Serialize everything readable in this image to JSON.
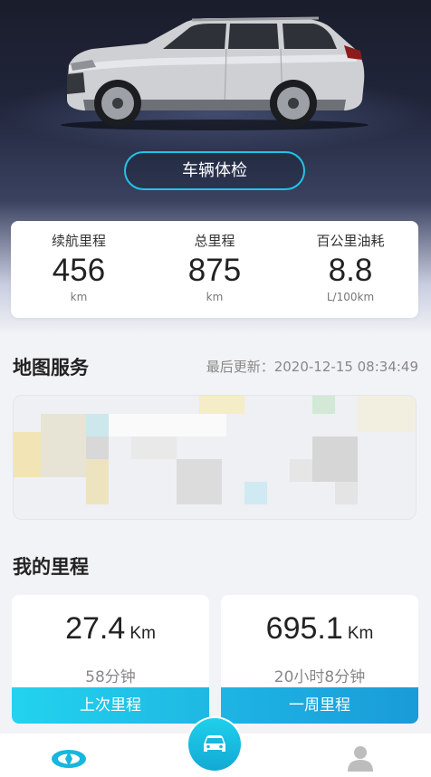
{
  "header": {
    "check_button": "车辆体检"
  },
  "stats": [
    {
      "label": "续航里程",
      "value": "456",
      "unit": "km"
    },
    {
      "label": "总里程",
      "value": "875",
      "unit": "km"
    },
    {
      "label": "百公里油耗",
      "value": "8.8",
      "unit": "L/100km"
    }
  ],
  "map": {
    "title": "地图服务",
    "updated": "最后更新：2020-12-15 08:34:49"
  },
  "trips": {
    "title": "我的里程",
    "cards": [
      {
        "value": "27.4",
        "unit": "Km",
        "time": "58分钟",
        "label": "上次里程"
      },
      {
        "value": "695.1",
        "unit": "Km",
        "time": "20小时8分钟",
        "label": "一周里程"
      }
    ]
  },
  "tabbar": {
    "items": [
      "brand-logo-icon",
      "car-icon",
      "user-icon"
    ]
  },
  "colors": {
    "accent": "#20c4e8",
    "bar_left": "#20c9ea",
    "bar_right": "#1ba6dc"
  }
}
